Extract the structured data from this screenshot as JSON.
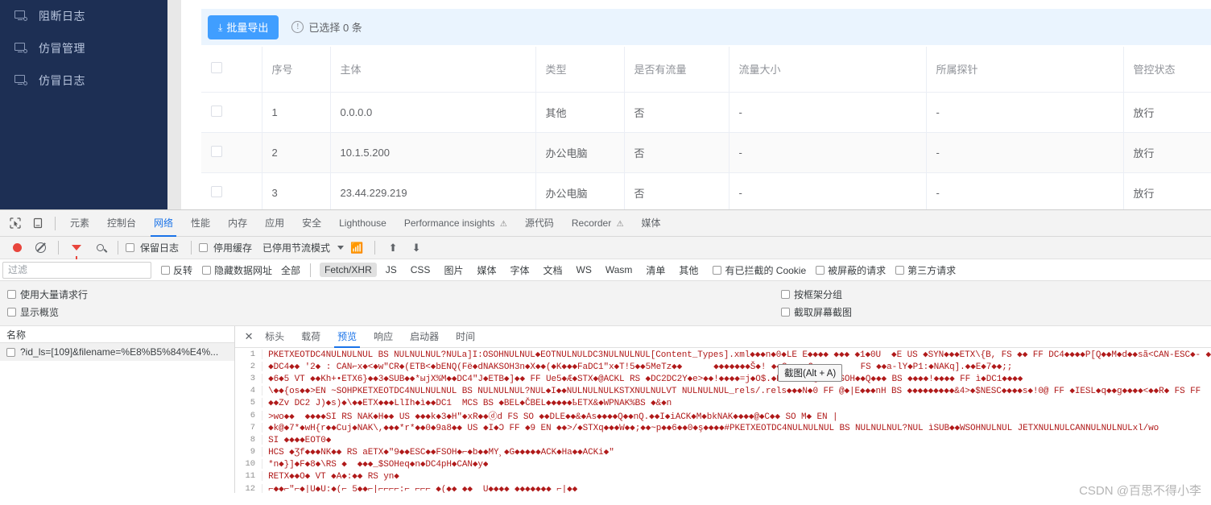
{
  "sidebar": {
    "items": [
      {
        "label": "阻断日志",
        "icon": "monitor-icon"
      },
      {
        "label": "仿冒管理",
        "icon": "monitor-icon"
      },
      {
        "label": "仿冒日志",
        "icon": "monitor-icon"
      }
    ]
  },
  "toolbar": {
    "export_label": "批量导出",
    "download_icon": "download-icon",
    "info_icon": "exclamation-circle-icon",
    "selection_text": "已选择 0 条"
  },
  "table": {
    "columns": [
      "",
      "序号",
      "主体",
      "类型",
      "是否有流量",
      "流量大小",
      "所属探针",
      "管控状态"
    ],
    "rows": [
      {
        "index": "1",
        "subject": "0.0.0.0",
        "type": "其他",
        "has_traffic": "否",
        "traffic_size": "-",
        "probe": "-",
        "status": "放行"
      },
      {
        "index": "2",
        "subject": "10.1.5.200",
        "type": "办公电脑",
        "has_traffic": "否",
        "traffic_size": "-",
        "probe": "-",
        "status": "放行"
      },
      {
        "index": "3",
        "subject": "23.44.229.219",
        "type": "办公电脑",
        "has_traffic": "否",
        "traffic_size": "-",
        "probe": "-",
        "status": "放行"
      }
    ]
  },
  "devtools": {
    "panel_tabs": [
      {
        "label": "元素",
        "active": false
      },
      {
        "label": "控制台",
        "active": false
      },
      {
        "label": "网络",
        "active": true
      },
      {
        "label": "性能",
        "active": false
      },
      {
        "label": "内存",
        "active": false
      },
      {
        "label": "应用",
        "active": false
      },
      {
        "label": "安全",
        "active": false
      },
      {
        "label": "Lighthouse",
        "active": false
      },
      {
        "label": "Performance insights",
        "active": false,
        "badge": "warning-icon"
      },
      {
        "label": "源代码",
        "active": false
      },
      {
        "label": "Recorder",
        "active": false,
        "badge": "warning-icon"
      },
      {
        "label": "媒体",
        "active": false
      }
    ],
    "network_toolbar": {
      "record_icon": "record-icon",
      "clear_icon": "clear-icon",
      "filter_icon": "filter-funnel-icon",
      "search_icon": "search-icon",
      "preserve_log": "保留日志",
      "disable_cache": "停用缓存",
      "throttling": "已停用节流模式",
      "dropdown_icon": "chevron-down-icon",
      "network_conditions_icon": "wifi-settings-icon",
      "import_icon": "upload-arrow-icon",
      "export_icon": "download-arrow-icon"
    },
    "filter_bar": {
      "placeholder": "过滤",
      "value": "",
      "invert": "反转",
      "hide_data_urls": "隐藏数据网址",
      "types": [
        "全部",
        "Fetch/XHR",
        "JS",
        "CSS",
        "图片",
        "媒体",
        "字体",
        "文档",
        "WS",
        "Wasm",
        "清单",
        "其他"
      ],
      "selected_type": "Fetch/XHR",
      "blocked_cookies": "有已拦截的 Cookie",
      "blocked_requests": "被屏蔽的请求",
      "third_party": "第三方请求"
    },
    "settings": {
      "big_request_rows": "使用大量请求行",
      "group_by_frame": "按框架分组",
      "show_overview": "显示概览",
      "capture_screenshots": "截取屏幕截图"
    },
    "request_list": {
      "header": "名称",
      "rows": [
        {
          "name": "?id_ls=[109]&filename=%E8%B5%84%E4%..."
        }
      ]
    },
    "detail_tabs": [
      {
        "label": "标头",
        "active": false
      },
      {
        "label": "载荷",
        "active": false
      },
      {
        "label": "预览",
        "active": true
      },
      {
        "label": "响应",
        "active": false
      },
      {
        "label": "启动器",
        "active": false
      },
      {
        "label": "时间",
        "active": false
      }
    ],
    "close_icon": "close-icon",
    "preview_lines": [
      {
        "num": "1",
        "text": "PKETXEOTDC4NULNULNUL BS NULNULNUL?NULa]I:OSOHNULNUL◆EOTNULNULDC3NULNULNUL[Content_Types].xml◆◆◆n◆0◆LE E◆◆◆◆ ◆◆◆ ◆1◆0U  ◆E US ◆SYN◆◆◆ETX\\{B, FS ◆◆ FF DC4◆◆◆◆P[Q◆◆M◆d◆◆sã<CAN-ESC◆- ◆"
      },
      {
        "num": "2",
        "text": "◆DC4◆◆ '2◆ : CAN⌐x◆<◆w\"CR◆(ETB<◆bENQ(Fë◆dNAKSOH3n◆X◆◆(◆K◆◆◆FaDC1\"x◆T!5◆◆5MeTz◆◆      ◆◆◆◆◆◆◆Š◆! ◆◆G◆◆◆◆Q◆◆◆◆◆    FS ◆◆a-lY◆P1:◆NAKq].◆◆E◆7◆◆;;"
      },
      {
        "num": "3",
        "text": "◆6◆5 VT ◆◆Kh+•ETX6}◆◆3◆SUB◆◆*ыjX%M◆◆DC4\"J◆ETB◆]◆◆ FF Ue5◆Æ◆STX◆@ACKL RS ◆DC2DC2Y◆e>◆◆!◆◆◆◆=j◆O$.◆DZ9◆◆GR@EN ◆SOH◆◆Q◆◆◆ BS ◆◆◆◆!◆◆◆◆ FF ì◆DC1◆◆◆◆"
      },
      {
        "num": "4",
        "text": "\\◆◆{os◆◆>EN ~SOHPKETXEOTDC4NULNULNUL BS NULNULNUL?NUL◆I◆◆NULNULNULKSTXNULNULVT NULNULNUL_rels/.rels◆◆◆N◆0 FF @◆|E◆◆◆nH BS ◆◆◆◆◆◆◆◆◆&4>◆$NESC◆◆◆◆s◆!0@ FF ◆IESL◆q◆◆g◆◆◆◆<◆◆R◆ FS FF"
      },
      {
        "num": "5",
        "text": "◆◆Zv DC2 J)◆s)◆\\◆◆ETX◆◆◆LlIh◆ì◆◆DC1  MCS BS ◆BEL◆ČBEL◆◆◆◆◆ҍETX&◆WPNAK%BS ◆&◆n"
      },
      {
        "num": "6",
        "text": ">wo◆◆  ◆◆◆◆SI RS NAK◆H◆◆ US ◆◆◆k◆3◆H\"◆xR◆◆ⓓd FS SO ◆◆DLE◆◆&◆As◆◆◆◆Q◆◆nQ.◆◆I◆iACK◆M◆bkNAK◆◆◆◆@◆C◆◆ SO M◆ EN |"
      },
      {
        "num": "7",
        "text": "◆k@◆7*◆wH{r◆◆Cuj◆NAK\\,◆◆◆*r*◆◆0◆9a8◆◆ US ◆I◆Ͻ FF ◆9 EN ◆◆>/◆STXq◆◆◆W◆◆;◆◆~p◆◆6◆◆0◆ş◆◆◆◆#PKETXEOTDC4NULNULNUL BS NULNULNUL?NUL ìSUB◆◆WSOHNULNUL JETXNULNULCANNULNULNULxl/wo"
      },
      {
        "num": "8",
        "text": "SI ◆◆◆◆EOT0◆"
      },
      {
        "num": "9",
        "text": "HCS ◆Ʒf◆◆◆NK◆◆ RS aETX◆\"9◆◆ESC◆◆FSOH◆⌐◆b◆◆MY¸◆G◆◆◆◆◆ACK◆Ha◆◆ACKi◆\""
      },
      {
        "num": "10",
        "text": "*n◆}]◆F◆8◆\\RS ◆  ◆◆◆_$SOHeq◆n◆DC4pH◆CAN◆y◆"
      },
      {
        "num": "11",
        "text": "RETX◆◆O◆ VT ◆A◆:◆◆ RS yn◆"
      },
      {
        "num": "12",
        "text": "⌐◆◆⌐\"⌐◆|U◆U:◆(⌐ 5◆◆⌐|⌐⌐⌐⌐:⌐ ⌐⌐⌐ ◆(◆◆ ◆◆  U◆◆◆◆ ◆◆◆◆◆◆◆ ⌐|◆◆"
      }
    ],
    "tooltip": "截图(Alt + A)"
  },
  "watermark": "CSDN @百思不得小李",
  "colors": {
    "sidebar_bg": "#1d2f54",
    "accent_blue": "#409eff",
    "devtools_accent": "#1a73e8",
    "record_red": "#e8453c"
  }
}
